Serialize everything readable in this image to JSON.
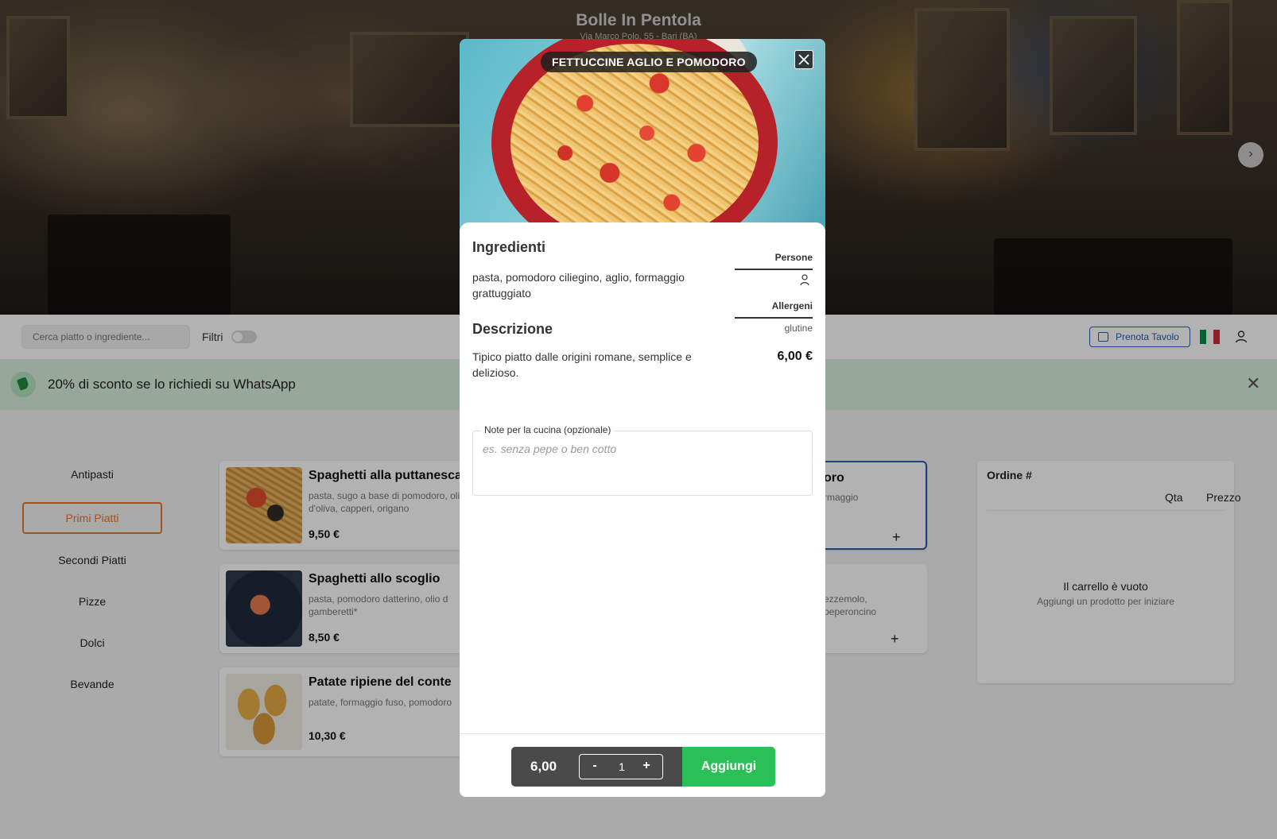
{
  "restaurant": {
    "name": "Bolle In Pentola",
    "address": "Via Marco Polo, 55 - Bari (BA)"
  },
  "toolbar": {
    "search_placeholder": "Cerca piatto o ingrediente...",
    "filters_label": "Filtri",
    "book_table_label": "Prenota Tavolo"
  },
  "promo": {
    "text": "20% di sconto se lo richiedi su WhatsApp"
  },
  "categories": [
    {
      "label": "Antipasti"
    },
    {
      "label": "Primi Piatti"
    },
    {
      "label": "Secondi Piatti"
    },
    {
      "label": "Pizze"
    },
    {
      "label": "Dolci"
    },
    {
      "label": "Bevande"
    }
  ],
  "products": [
    {
      "name": "Spaghetti alla puttanesca",
      "ingredients": "pasta, sugo a base di pomodoro, olio d'oliva, capperi, origano",
      "price": "9,50 €"
    },
    {
      "name": "Spaghetti allo scoglio",
      "ingredients": "pasta, pomodoro datterino, olio d gamberetti*",
      "price": "8,50 €"
    },
    {
      "name": "Patate ripiene del conte",
      "ingredients": "patate, formaggio fuso, pomodoro",
      "price": "10,30 €"
    }
  ],
  "right_cards": [
    {
      "name_fragment": "oro",
      "ingredients_fragment": "rmaggio",
      "add_label": "+"
    },
    {
      "ingredients_fragment": "ezzemolo, peperoncino",
      "add_label": "+"
    }
  ],
  "order": {
    "title": "Ordine #",
    "col_qty": "Qta",
    "col_price": "Prezzo",
    "empty_title": "Il carrello è vuoto",
    "empty_sub": "Aggiungi un prodotto per iniziare"
  },
  "modal": {
    "title": "FETTUCCINE AGLIO E POMODORO",
    "ingredients_heading": "Ingredienti",
    "ingredients_text": "pasta, pomodoro ciliegino, aglio, formaggio grattuggiato",
    "description_heading": "Descrizione",
    "description_text": "Tipico piatto dalle origini romane, semplice e delizioso.",
    "persons_label": "Persone",
    "persons_count": 1,
    "allergens_label": "Allergeni",
    "allergens_value": "glutine",
    "price": "6,00 €",
    "notes_label": "Note per la cucina (opzionale)",
    "notes_placeholder": "es. senza pepe o ben cotto",
    "total": "6,00",
    "minus_label": "-",
    "quantity": "1",
    "plus_label": "+",
    "add_label": "Aggiungi"
  },
  "colors": {
    "accent_orange": "#e8782a",
    "accent_blue": "#2a5bb0",
    "add_green": "#2bbf57",
    "promo_bg": "#d9f0de",
    "flag_green": "#009246",
    "flag_white": "#ffffff",
    "flag_red": "#ce2b37"
  },
  "icons": {
    "hero_next": "chevron-right-icon",
    "promo": "tag-icon",
    "promo_close": "close-icon",
    "calendar": "calendar-icon",
    "flag": "italy-flag-icon",
    "user": "user-icon",
    "person": "person-icon",
    "modal_close": "close-icon"
  }
}
